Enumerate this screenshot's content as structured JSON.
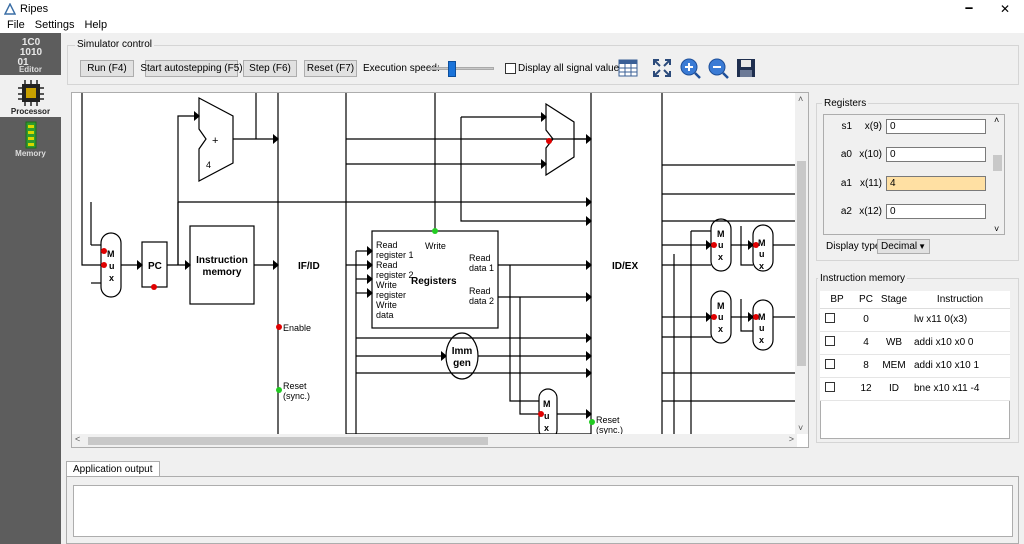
{
  "window": {
    "title": "Ripes",
    "minimize": "🗕",
    "maximize": "🗗",
    "close": "✕"
  },
  "menu": [
    "File",
    "Settings",
    "Help"
  ],
  "sidebar": [
    {
      "label": "Editor",
      "icon": "editor-icon",
      "glyph": "1C0\n1010\n01"
    },
    {
      "label": "Processor",
      "icon": "processor-icon"
    },
    {
      "label": "Memory",
      "icon": "memory-icon"
    }
  ],
  "simctl": {
    "title": "Simulator control",
    "run": "Run (F4)",
    "autostep": "Start autostepping (F5)",
    "step": "Step (F6)",
    "reset": "Reset (F7)",
    "speed_label": "Execution speed:",
    "speed_level": 0.3,
    "display_all": "Display all signal values",
    "icons": [
      "table-icon",
      "expand-icon",
      "zoom-in-icon",
      "zoom-out-icon",
      "save-icon"
    ]
  },
  "diagram": {
    "instr_mem_1": "Instruction",
    "instr_mem_2": "memory",
    "pc": "PC",
    "ifid": "IF/ID",
    "idex": "ID/EX",
    "registers": "Registers",
    "read_reg1_a": "Read",
    "read_reg1_b": "register 1",
    "read_reg2_a": "Read",
    "read_reg2_b": "register 2",
    "write_reg_a": "Write",
    "write_reg_b": "register",
    "write_data_a": "Write",
    "write_data_b": "data",
    "write": "Write",
    "read_data1_a": "Read",
    "read_data1_b": "data 1",
    "read_data2_a": "Read",
    "read_data2_b": "data 2",
    "imm1": "Imm",
    "imm2": "gen",
    "enable": "Enable",
    "reset1_a": "Reset",
    "reset1_b": "(sync.)",
    "reset2_a": "Reset",
    "reset2_b": "(sync.)",
    "plus": "+",
    "four": "4",
    "mux_m": "M",
    "mux_u": "u",
    "mux_x": "x"
  },
  "registers": {
    "title": "Registers",
    "rows": [
      {
        "name": "s1",
        "alias": "x(9)",
        "value": "0",
        "highlight": false
      },
      {
        "name": "a0",
        "alias": "x(10)",
        "value": "0",
        "highlight": false
      },
      {
        "name": "a1",
        "alias": "x(11)",
        "value": "4",
        "highlight": true
      },
      {
        "name": "a2",
        "alias": "x(12)",
        "value": "0",
        "highlight": false
      }
    ],
    "display_type_label": "Display type:",
    "display_type": "Decimal"
  },
  "imem": {
    "title": "Instruction memory",
    "headers": [
      "BP",
      "PC",
      "Stage",
      "Instruction"
    ],
    "rows": [
      {
        "pc": "0",
        "stage": "",
        "instr": "lw x11 0(x3)"
      },
      {
        "pc": "4",
        "stage": "WB",
        "instr": "addi x10 x0 0"
      },
      {
        "pc": "8",
        "stage": "MEM",
        "instr": "addi x10 x10 1"
      },
      {
        "pc": "12",
        "stage": "ID",
        "instr": "bne x10 x11 -4"
      }
    ]
  },
  "output": {
    "tab": "Application output"
  },
  "colors": {
    "sidebar": "#5d5d5d",
    "highlight": "#ffe0a3",
    "signal_red": "#e00000",
    "signal_green": "#22cc22",
    "slider": "#1a73d9"
  }
}
